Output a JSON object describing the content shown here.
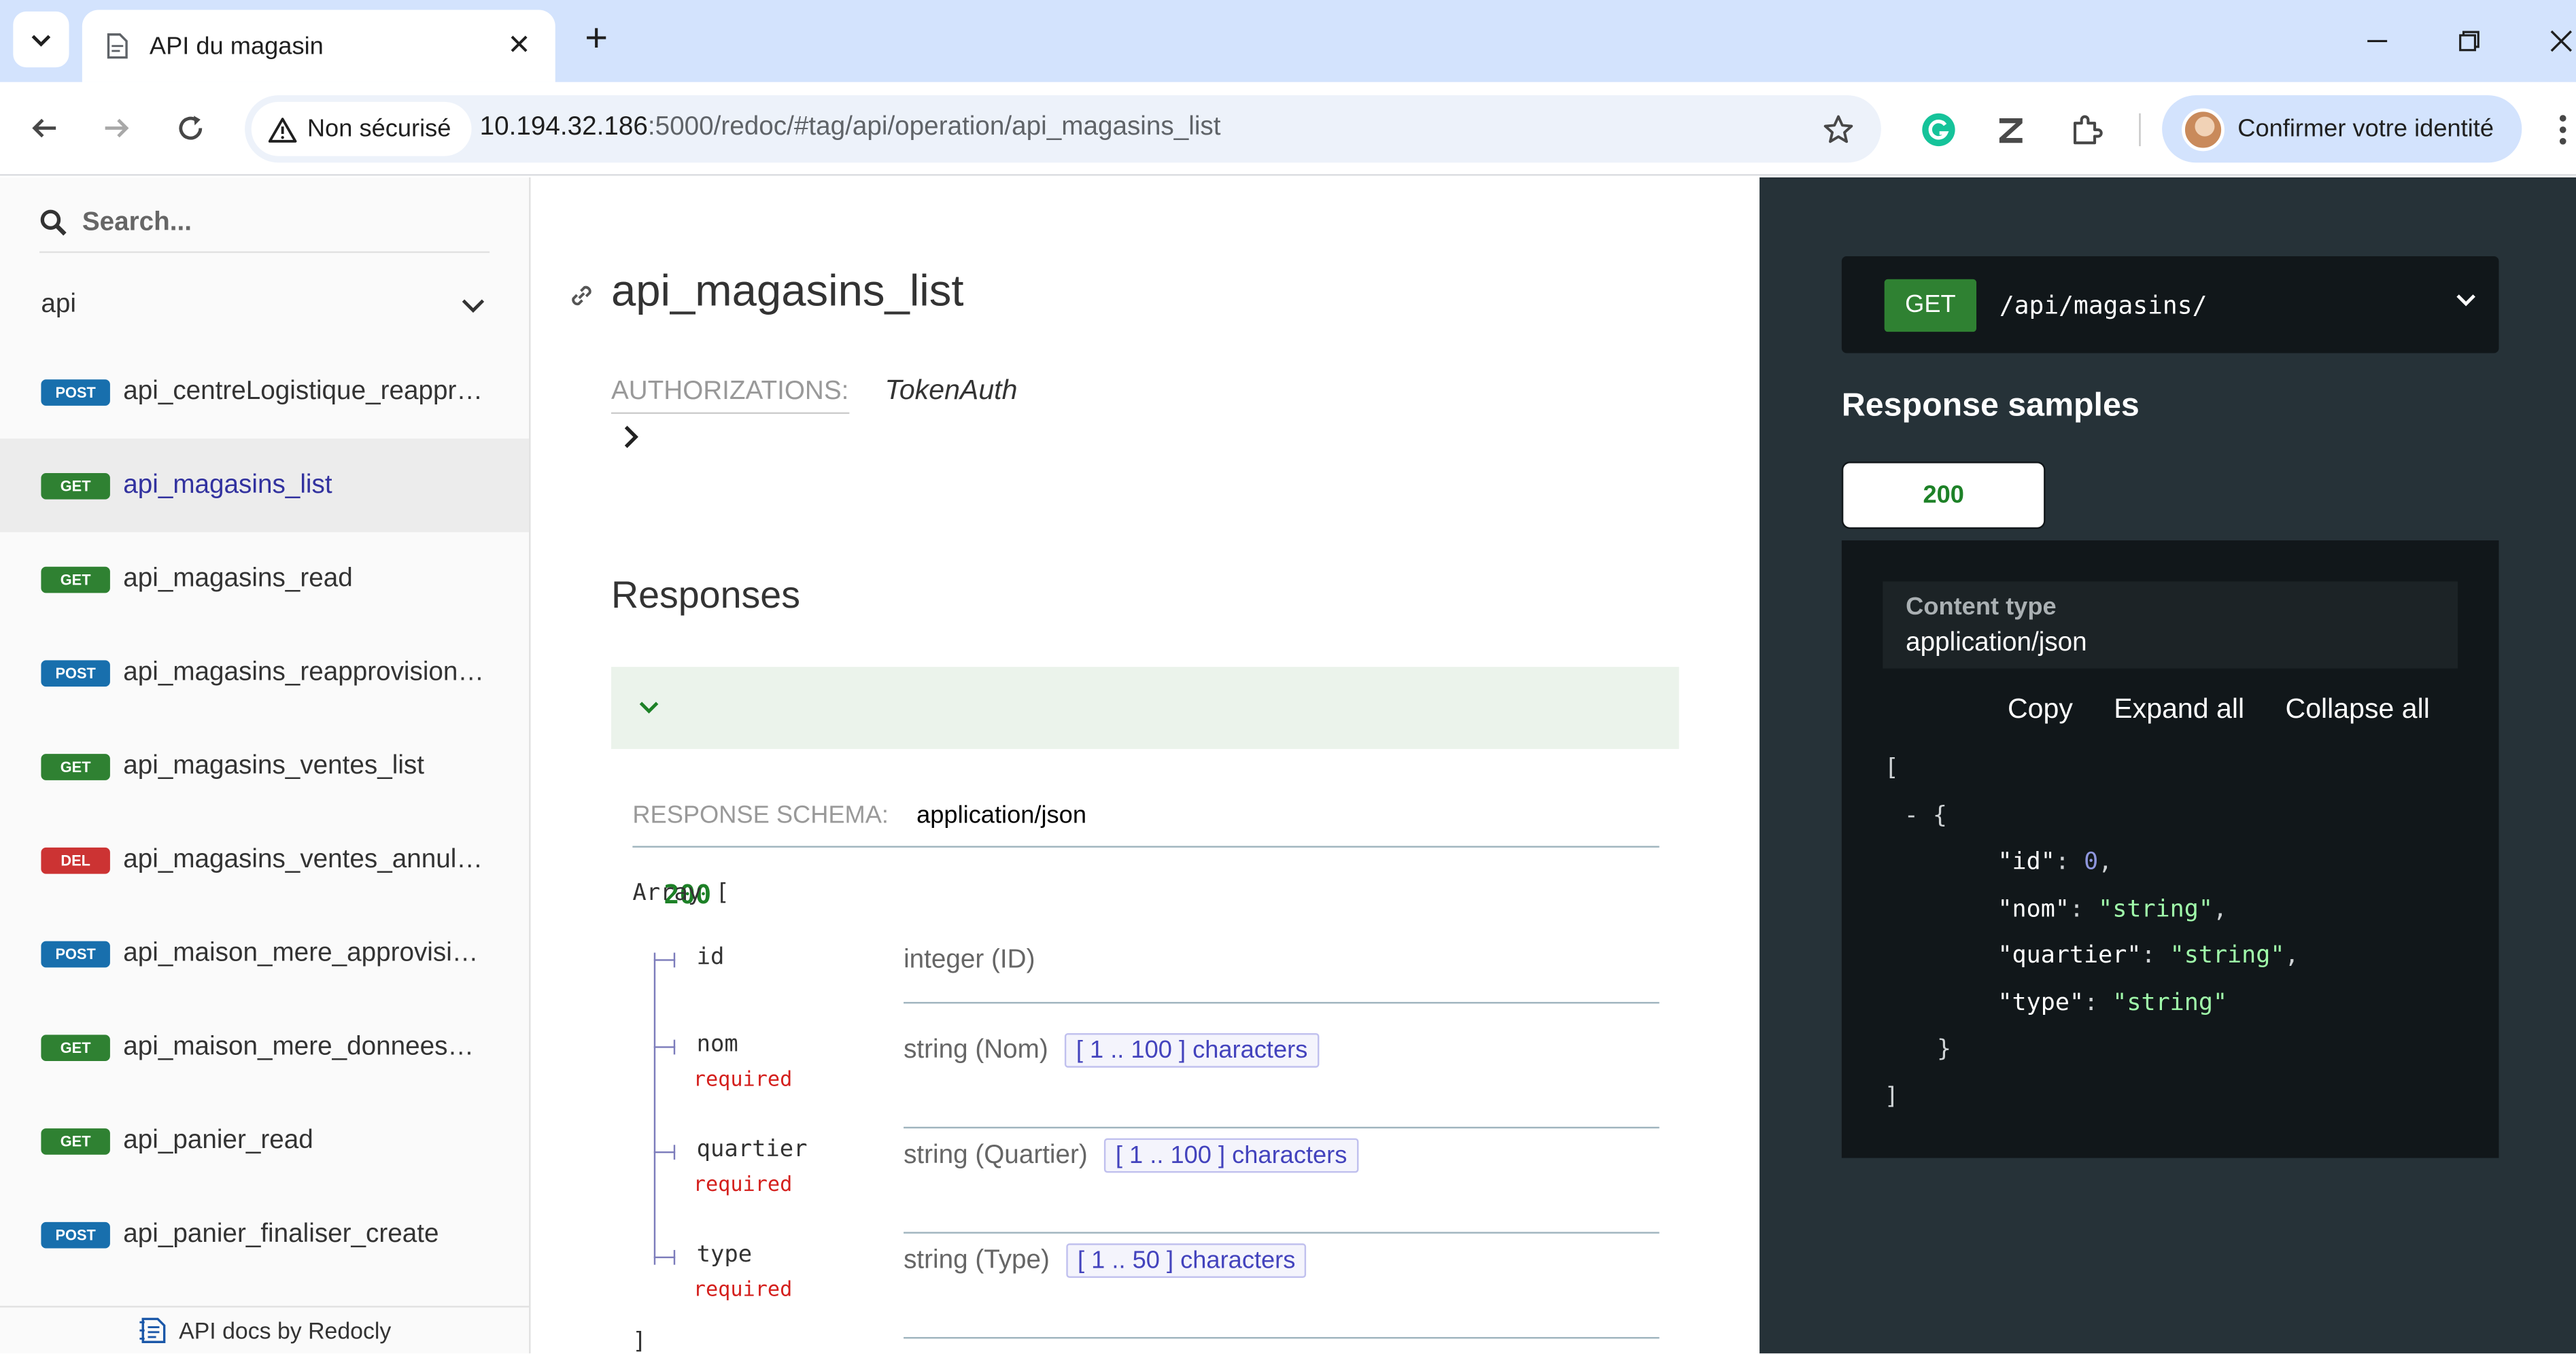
{
  "browser": {
    "tab_title": "API du magasin",
    "security_label": "Non sécurisé",
    "url_host": "10.194.32.186",
    "url_rest": ":5000/redoc/#tag/api/operation/api_magasins_list",
    "profile_label": "Confirmer votre identité",
    "icons": [
      "tab-search-icon",
      "document-icon",
      "close-icon",
      "plus-icon",
      "minimize-icon",
      "restore-icon",
      "close-window-icon",
      "back-arrow-icon",
      "forward-arrow-icon",
      "reload-icon",
      "warning-icon",
      "star-icon",
      "grammarly-icon",
      "zotero-icon",
      "extensions-icon",
      "kebab-menu-icon"
    ]
  },
  "sidebar": {
    "search_placeholder": "Search...",
    "group_label": "api",
    "items": [
      {
        "method": "POST",
        "label": "api_centreLogistique_reappr…",
        "color": "#186fad"
      },
      {
        "method": "GET",
        "label": "api_magasins_list",
        "color": "#2f8132"
      },
      {
        "method": "GET",
        "label": "api_magasins_read",
        "color": "#2f8132"
      },
      {
        "method": "POST",
        "label": "api_magasins_reapprovision…",
        "color": "#186fad"
      },
      {
        "method": "GET",
        "label": "api_magasins_ventes_list",
        "color": "#2f8132"
      },
      {
        "method": "DEL",
        "label": "api_magasins_ventes_annul…",
        "color": "#cc3333"
      },
      {
        "method": "POST",
        "label": "api_maison_mere_approvisi…",
        "color": "#186fad"
      },
      {
        "method": "GET",
        "label": "api_maison_mere_donnees…",
        "color": "#2f8132"
      },
      {
        "method": "GET",
        "label": "api_panier_read",
        "color": "#2f8132"
      },
      {
        "method": "POST",
        "label": "api_panier_finaliser_create",
        "color": "#186fad"
      }
    ],
    "active_index": 1,
    "powered_by": "API docs by Redocly"
  },
  "operation": {
    "title": "api_magasins_list",
    "auth_label": "AUTHORIZATIONS:",
    "auth_value": "TokenAuth",
    "responses_heading": "Responses",
    "response_code": "200",
    "schema_label": "RESPONSE SCHEMA:",
    "schema_type": "application/json",
    "array_open": "Array [",
    "array_close": "]",
    "properties": [
      {
        "name": "id",
        "required": "",
        "type": "integer (ID)",
        "constraint": ""
      },
      {
        "name": "nom",
        "required": "required",
        "type": "string (Nom)",
        "constraint": "[ 1 .. 100 ] characters"
      },
      {
        "name": "quartier",
        "required": "required",
        "type": "string (Quartier)",
        "constraint": "[ 1 .. 100 ] characters"
      },
      {
        "name": "type",
        "required": "required",
        "type": "string (Type)",
        "constraint": "[ 1 .. 50 ] characters"
      }
    ]
  },
  "panel": {
    "method": "GET",
    "path": "/api/magasins/",
    "samples_title": "Response samples",
    "status_tab": "200",
    "content_type_label": "Content type",
    "content_type_value": "application/json",
    "copy": "Copy",
    "expand_all": "Expand all",
    "collapse_all": "Collapse all",
    "json_sample": {
      "open": "[",
      "item_open": "- {",
      "fields": [
        {
          "key": "\"id\"",
          "value": "0",
          "kind": "num",
          "sep": ","
        },
        {
          "key": "\"nom\"",
          "value": "\"string\"",
          "kind": "str",
          "sep": ","
        },
        {
          "key": "\"quartier\"",
          "value": "\"string\"",
          "kind": "str",
          "sep": ","
        },
        {
          "key": "\"type\"",
          "value": "\"string\"",
          "kind": "str",
          "sep": ""
        }
      ],
      "item_close": "}",
      "close": "]"
    }
  }
}
